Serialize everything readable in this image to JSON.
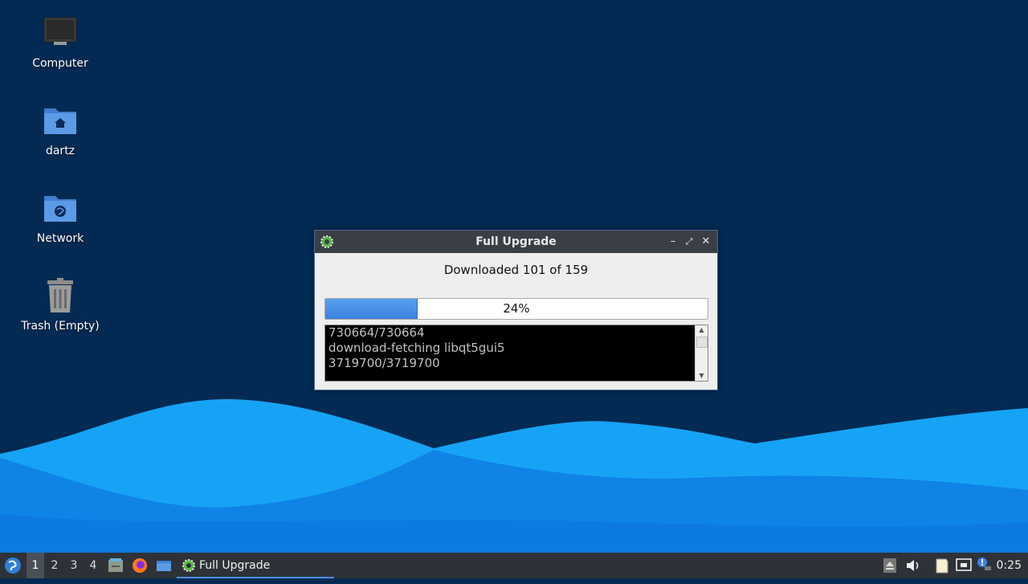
{
  "desktop": {
    "icons": [
      {
        "label": "Computer",
        "icon": "computer-icon"
      },
      {
        "label": "dartz",
        "icon": "home-folder-icon"
      },
      {
        "label": "Network",
        "icon": "network-folder-icon"
      },
      {
        "label": "Trash (Empty)",
        "icon": "trash-icon"
      }
    ]
  },
  "window": {
    "title": "Full Upgrade",
    "status": "Downloaded 101 of 159",
    "progress_label": "24%",
    "progress_fraction": 0.24,
    "log_lines": [
      "730664/730664",
      "download-fetching libqt5gui5",
      "3719700/3719700"
    ]
  },
  "taskbar": {
    "workspaces": [
      "1",
      "2",
      "3",
      "4"
    ],
    "active_workspace": "1",
    "task_label": "Full Upgrade",
    "clock": "0:25"
  },
  "colors": {
    "desktop_bg": "#022a52",
    "accent": "#3b82e0",
    "wave_light": "#1aa0f5"
  }
}
